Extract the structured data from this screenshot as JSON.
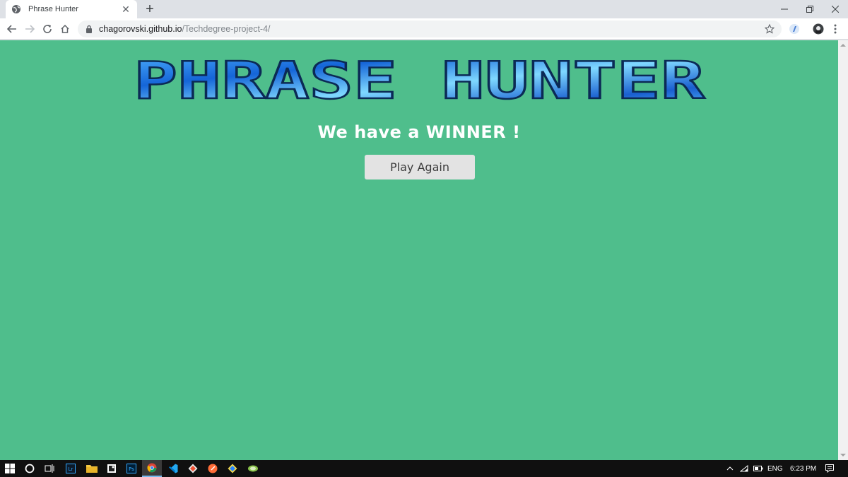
{
  "tab": {
    "title": "Phrase Hunter",
    "close_glyph": "✕"
  },
  "new_tab_glyph": "+",
  "window_controls": {
    "minimize": "—",
    "maximize": "❐",
    "close": "✕"
  },
  "omnibox": {
    "host": "chagorovski.github.io",
    "path": "/Techdegree-project-4/"
  },
  "page": {
    "title": "PHRASE HUNTER",
    "message": "We have a WINNER !",
    "button_label": "Play Again",
    "background_color": "#4fbe8c"
  },
  "taskbar": {
    "lang": "ENG",
    "time": "6:23 PM",
    "apps": [
      "windows-start-icon",
      "search-circle-icon",
      "task-view-icon",
      "lightroom-icon",
      "file-explorer-icon",
      "photo-app-icon",
      "photoshop-icon",
      "chrome-icon",
      "vscode-icon",
      "git-icon",
      "postman-icon",
      "sourcetree-icon",
      "tortoise-icon"
    ]
  }
}
